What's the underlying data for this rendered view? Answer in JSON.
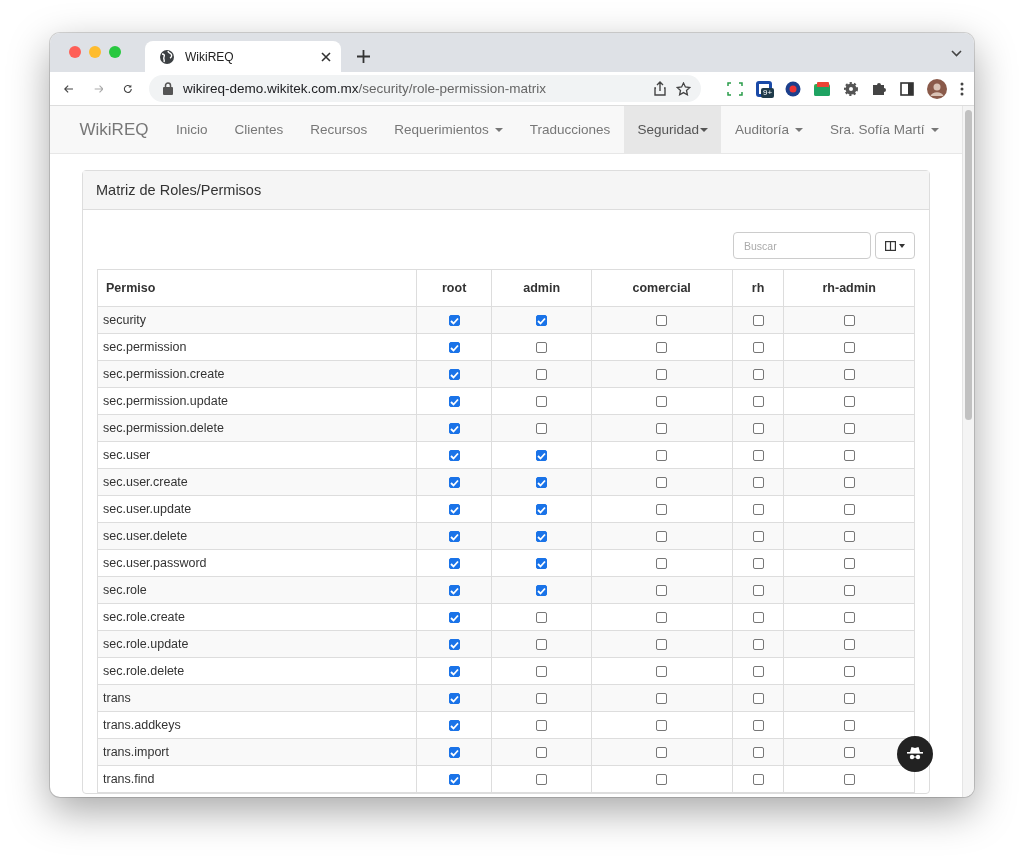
{
  "browser": {
    "tab_title": "WikiREQ",
    "url_host": "wikireq-demo.wikitek.com.mx",
    "url_path": "/security/role-permission-matrix",
    "extension_badge": "9+"
  },
  "navbar": {
    "brand": "WikiREQ",
    "items": [
      {
        "label": "Inicio",
        "dropdown": false,
        "selected": false
      },
      {
        "label": "Clientes",
        "dropdown": false,
        "selected": false
      },
      {
        "label": "Recursos",
        "dropdown": false,
        "selected": false
      },
      {
        "label": "Requerimientos",
        "dropdown": true,
        "selected": false
      },
      {
        "label": "Traducciones",
        "dropdown": false,
        "selected": false
      },
      {
        "label": "Seguridad",
        "dropdown": true,
        "selected": true
      },
      {
        "label": "Auditoría",
        "dropdown": true,
        "selected": false
      }
    ],
    "user": "Sra. Sofía Martí"
  },
  "panel": {
    "title": "Matriz de Roles/Permisos"
  },
  "search": {
    "placeholder": "Buscar"
  },
  "table": {
    "columns": [
      "Permiso",
      "root",
      "admin",
      "comercial",
      "rh",
      "rh-admin"
    ],
    "rows": [
      {
        "permission": "security",
        "cells": [
          {
            "checked": true
          },
          {
            "checked": true
          },
          {
            "checked": false
          },
          {
            "checked": false
          },
          {
            "checked": false
          }
        ]
      },
      {
        "permission": "sec.permission",
        "cells": [
          {
            "checked": true
          },
          {
            "checked": false
          },
          {
            "checked": false
          },
          {
            "checked": false
          },
          {
            "checked": false
          }
        ]
      },
      {
        "permission": "sec.permission.create",
        "cells": [
          {
            "checked": true
          },
          {
            "checked": false
          },
          {
            "checked": false
          },
          {
            "checked": false
          },
          {
            "checked": false
          }
        ]
      },
      {
        "permission": "sec.permission.update",
        "cells": [
          {
            "checked": true
          },
          {
            "checked": false
          },
          {
            "checked": false
          },
          {
            "checked": false
          },
          {
            "checked": false
          }
        ]
      },
      {
        "permission": "sec.permission.delete",
        "cells": [
          {
            "checked": true
          },
          {
            "checked": false
          },
          {
            "checked": false
          },
          {
            "checked": false
          },
          {
            "checked": false
          }
        ]
      },
      {
        "permission": "sec.user",
        "cells": [
          {
            "checked": true
          },
          {
            "checked": true
          },
          {
            "checked": false
          },
          {
            "checked": false
          },
          {
            "checked": false
          }
        ]
      },
      {
        "permission": "sec.user.create",
        "cells": [
          {
            "checked": true
          },
          {
            "checked": true
          },
          {
            "checked": false
          },
          {
            "checked": false
          },
          {
            "checked": false
          }
        ]
      },
      {
        "permission": "sec.user.update",
        "cells": [
          {
            "checked": true
          },
          {
            "checked": true
          },
          {
            "checked": false
          },
          {
            "checked": false
          },
          {
            "checked": false
          }
        ]
      },
      {
        "permission": "sec.user.delete",
        "cells": [
          {
            "checked": true
          },
          {
            "checked": true
          },
          {
            "checked": false
          },
          {
            "checked": false
          },
          {
            "checked": false
          }
        ]
      },
      {
        "permission": "sec.user.password",
        "cells": [
          {
            "checked": true
          },
          {
            "checked": true
          },
          {
            "checked": false
          },
          {
            "checked": false
          },
          {
            "checked": false
          }
        ]
      },
      {
        "permission": "sec.role",
        "cells": [
          {
            "checked": true
          },
          {
            "checked": true
          },
          {
            "checked": false
          },
          {
            "checked": false
          },
          {
            "checked": false
          }
        ]
      },
      {
        "permission": "sec.role.create",
        "cells": [
          {
            "checked": true
          },
          {
            "checked": false
          },
          {
            "checked": false
          },
          {
            "checked": false
          },
          {
            "checked": false
          }
        ]
      },
      {
        "permission": "sec.role.update",
        "cells": [
          {
            "checked": true
          },
          {
            "checked": false
          },
          {
            "checked": false
          },
          {
            "checked": false
          },
          {
            "checked": false
          }
        ]
      },
      {
        "permission": "sec.role.delete",
        "cells": [
          {
            "checked": true
          },
          {
            "checked": false
          },
          {
            "checked": false
          },
          {
            "checked": false
          },
          {
            "checked": false
          }
        ]
      },
      {
        "permission": "trans",
        "cells": [
          {
            "checked": true
          },
          {
            "checked": false
          },
          {
            "checked": false
          },
          {
            "checked": false
          },
          {
            "checked": false
          }
        ]
      },
      {
        "permission": "trans.addkeys",
        "cells": [
          {
            "checked": true
          },
          {
            "checked": false
          },
          {
            "checked": false
          },
          {
            "checked": false
          },
          {
            "checked": false
          }
        ]
      },
      {
        "permission": "trans.import",
        "cells": [
          {
            "checked": true
          },
          {
            "checked": false
          },
          {
            "checked": false
          },
          {
            "checked": false
          },
          {
            "checked": false
          }
        ]
      },
      {
        "permission": "trans.find",
        "cells": [
          {
            "checked": true
          },
          {
            "checked": false
          },
          {
            "checked": false
          },
          {
            "checked": false
          },
          {
            "checked": false
          }
        ]
      }
    ]
  }
}
